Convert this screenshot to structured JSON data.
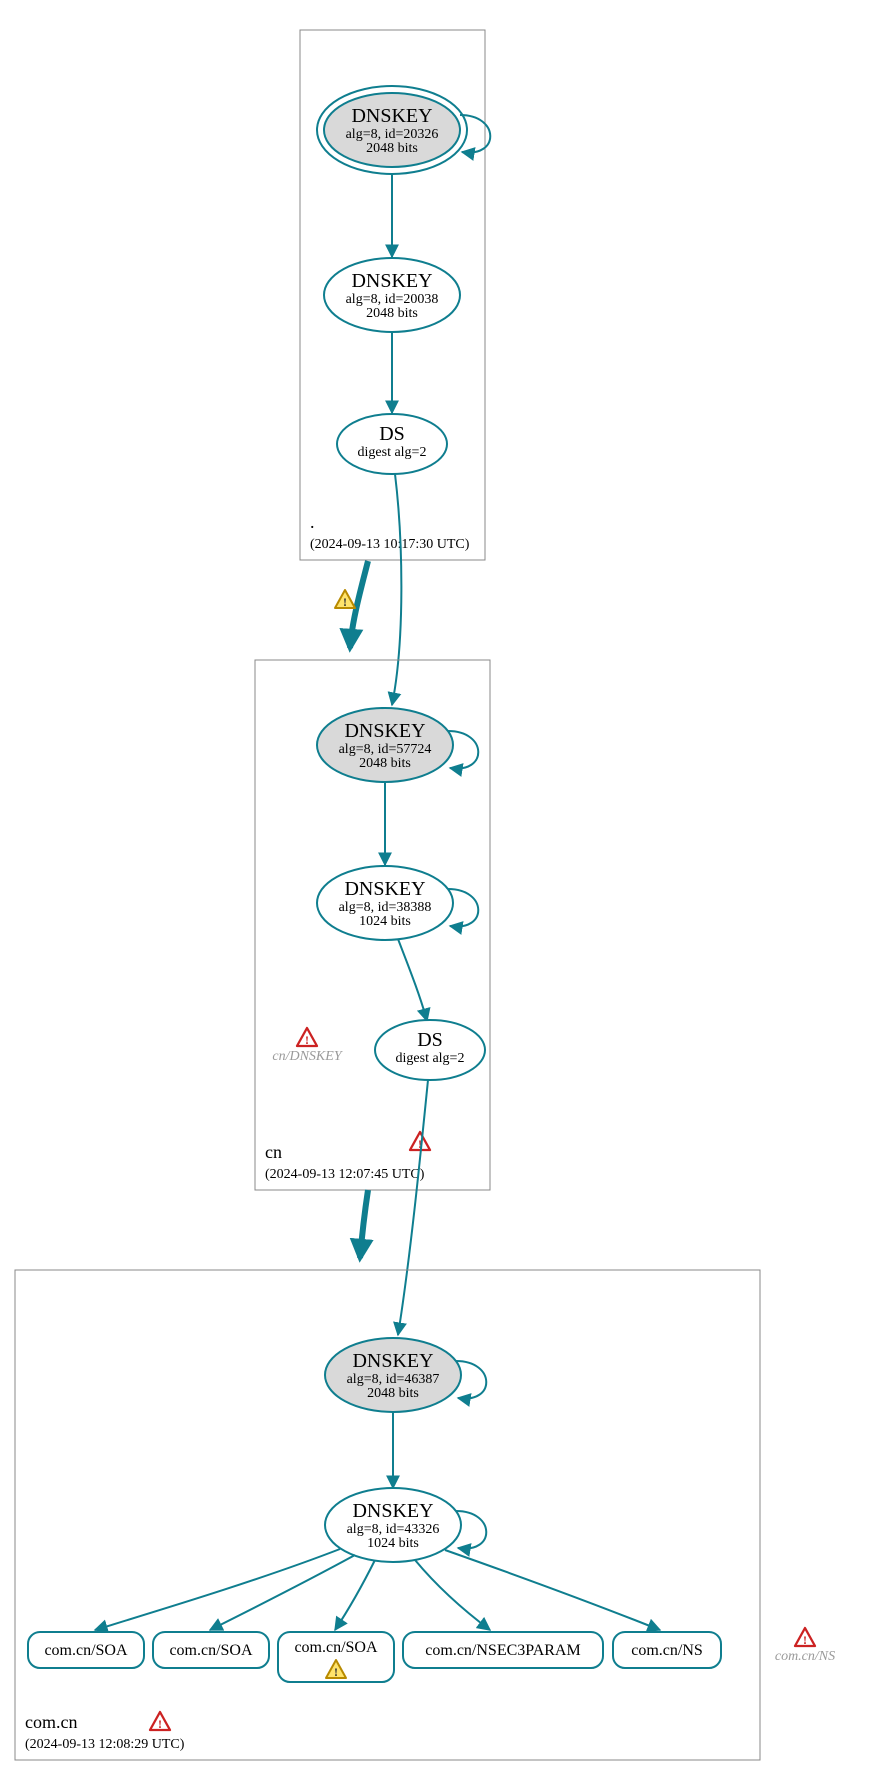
{
  "zones": {
    "root": {
      "name": ".",
      "timestamp": "(2024-09-13 10:17:30 UTC)",
      "ksk": {
        "title": "DNSKEY",
        "detail1": "alg=8, id=20326",
        "detail2": "2048 bits"
      },
      "zsk": {
        "title": "DNSKEY",
        "detail1": "alg=8, id=20038",
        "detail2": "2048 bits"
      },
      "ds": {
        "title": "DS",
        "detail1": "digest alg=2"
      }
    },
    "cn": {
      "name": "cn",
      "timestamp": "(2024-09-13 12:07:45 UTC)",
      "ksk": {
        "title": "DNSKEY",
        "detail1": "alg=8, id=57724",
        "detail2": "2048 bits"
      },
      "zsk": {
        "title": "DNSKEY",
        "detail1": "alg=8, id=38388",
        "detail2": "1024 bits"
      },
      "ds": {
        "title": "DS",
        "detail1": "digest alg=2"
      },
      "missing": "cn/DNSKEY"
    },
    "comcn": {
      "name": "com.cn",
      "timestamp": "(2024-09-13 12:08:29 UTC)",
      "ksk": {
        "title": "DNSKEY",
        "detail1": "alg=8, id=46387",
        "detail2": "2048 bits"
      },
      "zsk": {
        "title": "DNSKEY",
        "detail1": "alg=8, id=43326",
        "detail2": "1024 bits"
      },
      "rrsets": {
        "r1": "com.cn/SOA",
        "r2": "com.cn/SOA",
        "r3": "com.cn/SOA",
        "r4": "com.cn/NSEC3PARAM",
        "r5": "com.cn/NS"
      },
      "missing": "com.cn/NS"
    }
  }
}
